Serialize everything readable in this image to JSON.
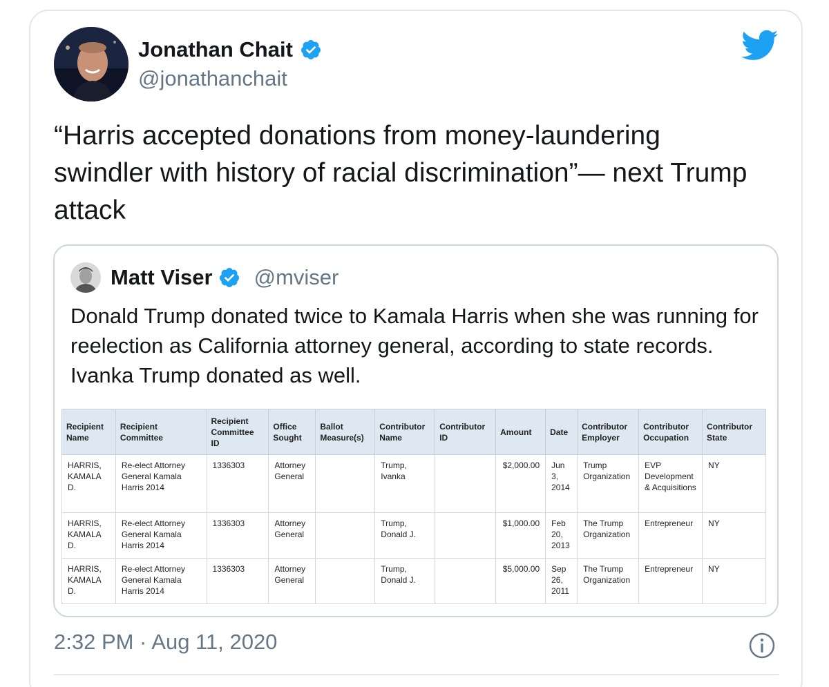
{
  "tweet": {
    "author_name": "Jonathan Chait",
    "author_handle": "@jonathanchait",
    "text": "“Harris accepted donations from money-laundering swindler with history of racial discrimination”— next Trump attack",
    "timestamp": "2:32 PM · Aug 11, 2020",
    "icons": {
      "brand": "twitter-bird-icon",
      "verified": "verified-badge-icon",
      "info": "info-icon"
    }
  },
  "quoted_tweet": {
    "author_name": "Matt Viser",
    "author_handle": "@mviser",
    "text": "Donald Trump donated twice to Kamala Harris when she was running for reelection as California attorney general, according to state records. Ivanka Trump donated as well."
  },
  "records_table": {
    "headers": [
      "Recipient Name",
      "Recipient Committee",
      "Recipient Committee ID",
      "Office Sought",
      "Ballot Measure(s)",
      "Contributor Name",
      "Contributor ID",
      "Amount",
      "Date",
      "Contributor Employer",
      "Contributor Occupation",
      "Contributor State"
    ],
    "rows": [
      [
        "HARRIS, KAMALA D.",
        "Re-elect Attorney General Kamala Harris 2014",
        "1336303",
        "Attorney General",
        "",
        "Trump, Ivanka",
        "",
        "$2,000.00",
        "Jun 3, 2014",
        "Trump Organization",
        "EVP Development & Acquisitions",
        "NY"
      ],
      [
        "HARRIS, KAMALA D.",
        "Re-elect Attorney General Kamala Harris 2014",
        "1336303",
        "Attorney General",
        "",
        "Trump, Donald J.",
        "",
        "$1,000.00",
        "Feb 20, 2013",
        "The Trump Organization",
        "Entrepreneur",
        "NY"
      ],
      [
        "HARRIS, KAMALA D.",
        "Re-elect Attorney General Kamala Harris 2014",
        "1336303",
        "Attorney General",
        "",
        "Trump, Donald J.",
        "",
        "$5,000.00",
        "Sep 26, 2011",
        "The Trump Organization",
        "Entrepreneur",
        "NY"
      ]
    ]
  },
  "colors": {
    "twitter_blue": "#1da1f2",
    "secondary_text": "#657786",
    "border": "#e1e8ed",
    "table_header_bg": "#dde8f2"
  }
}
